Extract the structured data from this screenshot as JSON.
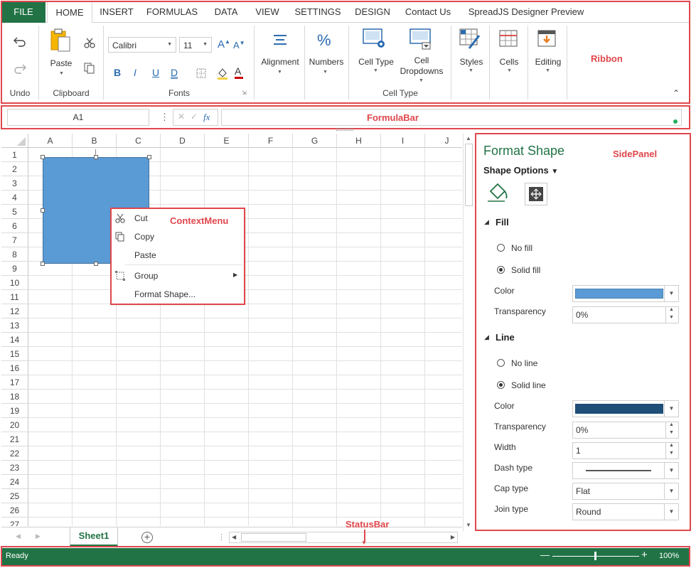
{
  "ribbon": {
    "tabs": [
      "FILE",
      "HOME",
      "INSERT",
      "FORMULAS",
      "DATA",
      "VIEW",
      "SETTINGS",
      "DESIGN",
      "Contact Us",
      "SpreadJS Designer Preview"
    ],
    "groups": {
      "undo": "Undo",
      "clipboard": "Clipboard",
      "fonts": "Fonts",
      "cell_type": "Cell Type"
    },
    "buttons": {
      "paste": "Paste",
      "alignment": "Alignment",
      "numbers": "Numbers",
      "cell_type": "Cell Type",
      "cell_dropdowns_1": "Cell",
      "cell_dropdowns_2": "Dropdowns",
      "styles": "Styles",
      "cells": "Cells",
      "editing": "Editing"
    },
    "font_name": "Calibri",
    "font_size": "11",
    "format_buttons": {
      "bold": "B",
      "italic": "I",
      "underline": "U",
      "double_underline": "D"
    }
  },
  "formula_bar": {
    "name_box": "A1",
    "fx": "fx"
  },
  "annotations": {
    "ribbon": "Ribbon",
    "formula_bar": "FormulaBar",
    "side_panel": "SidePanel",
    "context_menu": "ContextMenu",
    "status_bar": "StatusBar"
  },
  "grid": {
    "columns": [
      "A",
      "B",
      "C",
      "D",
      "E",
      "F",
      "G",
      "H",
      "I",
      "J"
    ],
    "rows": [
      "1",
      "2",
      "3",
      "4",
      "5",
      "6",
      "7",
      "8",
      "9",
      "10",
      "11",
      "12",
      "13",
      "14",
      "15",
      "16",
      "17",
      "18",
      "19",
      "20",
      "21",
      "22",
      "23",
      "24",
      "25",
      "26",
      "27"
    ],
    "shape_color": "#5b9bd5"
  },
  "context_menu": {
    "items": [
      "Cut",
      "Copy",
      "Paste",
      "Group",
      "Format Shape..."
    ]
  },
  "side_panel": {
    "title": "Format Shape",
    "options": "Shape Options",
    "fill": {
      "header": "Fill",
      "no_fill": "No fill",
      "solid_fill": "Solid fill",
      "color_label": "Color",
      "color": "#5b9bd5",
      "transparency_label": "Transparency",
      "transparency": "0%"
    },
    "line": {
      "header": "Line",
      "no_line": "No line",
      "solid_line": "Solid line",
      "color_label": "Color",
      "color": "#1f4e79",
      "transparency_label": "Transparency",
      "transparency": "0%",
      "width_label": "Width",
      "width": "1",
      "dash_label": "Dash type",
      "cap_label": "Cap type",
      "cap": "Flat",
      "join_label": "Join type",
      "join": "Round"
    }
  },
  "sheets": {
    "active": "Sheet1"
  },
  "status_bar": {
    "status": "Ready",
    "zoom": "100%"
  },
  "colors": {
    "accent": "#217346",
    "annotation": "#e0474c",
    "title_green": "#217346"
  }
}
